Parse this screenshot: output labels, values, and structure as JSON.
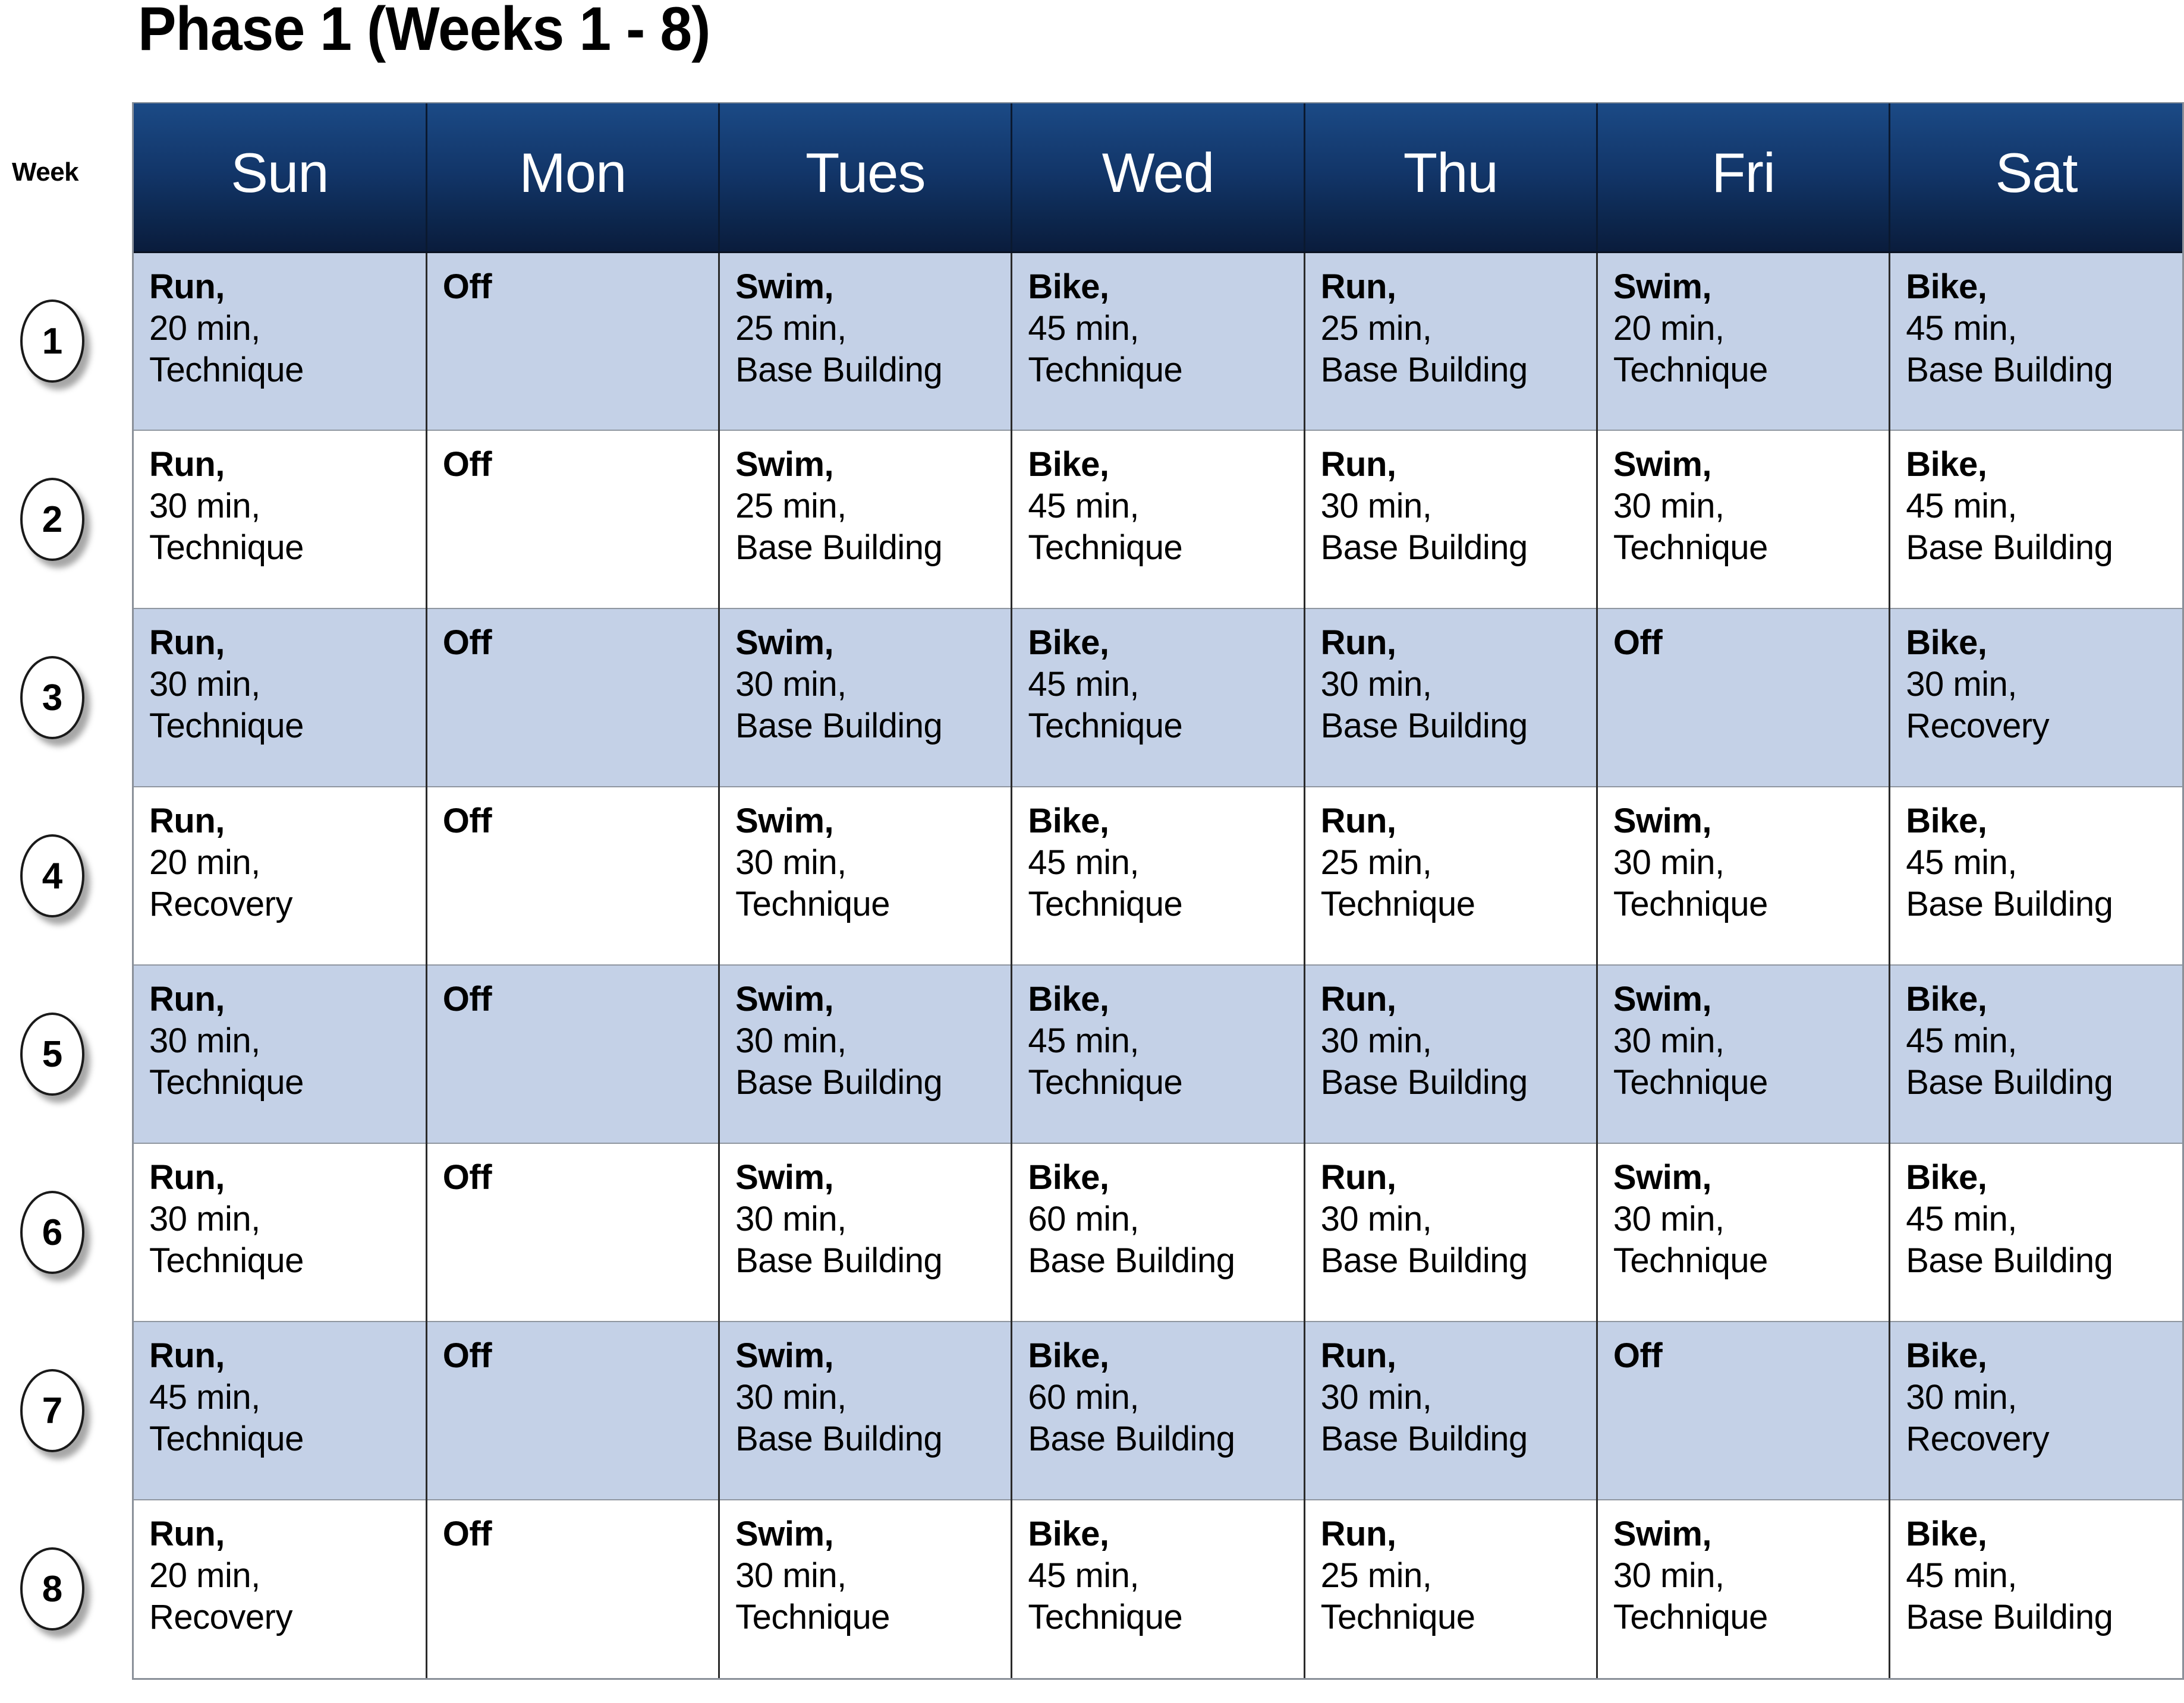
{
  "title": "Phase 1 (Weeks 1 - 8)",
  "week_column_label": "Week",
  "colors": {
    "header_top": "#1b4a86",
    "header_bottom": "#0a1c3c",
    "band_blue": "#c4d1e7",
    "band_white": "#ffffff",
    "text": "#000000",
    "header_text": "#ffffff"
  },
  "columns": [
    {
      "key": "sun",
      "label": "Sun"
    },
    {
      "key": "mon",
      "label": "Mon"
    },
    {
      "key": "tues",
      "label": "Tues"
    },
    {
      "key": "wed",
      "label": "Wed"
    },
    {
      "key": "thu",
      "label": "Thu"
    },
    {
      "key": "fri",
      "label": "Fri"
    },
    {
      "key": "sat",
      "label": "Sat"
    }
  ],
  "rows": [
    {
      "week": "1",
      "shaded": true,
      "cells": [
        {
          "activity": "Run",
          "duration": "20 min",
          "focus": "Technique"
        },
        {
          "activity": "Off",
          "duration": "",
          "focus": ""
        },
        {
          "activity": "Swim",
          "duration": "25 min",
          "focus": "Base Building"
        },
        {
          "activity": "Bike",
          "duration": "45 min",
          "focus": "Technique"
        },
        {
          "activity": "Run",
          "duration": "25 min",
          "focus": "Base Building"
        },
        {
          "activity": "Swim",
          "duration": "20 min",
          "focus": "Technique"
        },
        {
          "activity": "Bike",
          "duration": "45 min",
          "focus": "Base Building"
        }
      ]
    },
    {
      "week": "2",
      "shaded": false,
      "cells": [
        {
          "activity": "Run",
          "duration": "30 min",
          "focus": "Technique"
        },
        {
          "activity": "Off",
          "duration": "",
          "focus": ""
        },
        {
          "activity": "Swim",
          "duration": "25 min",
          "focus": "Base Building"
        },
        {
          "activity": "Bike",
          "duration": "45 min",
          "focus": "Technique"
        },
        {
          "activity": "Run",
          "duration": "30 min",
          "focus": "Base Building"
        },
        {
          "activity": "Swim",
          "duration": "30 min",
          "focus": "Technique"
        },
        {
          "activity": "Bike",
          "duration": "45 min",
          "focus": "Base Building"
        }
      ]
    },
    {
      "week": "3",
      "shaded": true,
      "cells": [
        {
          "activity": "Run",
          "duration": "30 min",
          "focus": "Technique"
        },
        {
          "activity": "Off",
          "duration": "",
          "focus": ""
        },
        {
          "activity": "Swim",
          "duration": "30 min",
          "focus": "Base Building"
        },
        {
          "activity": "Bike",
          "duration": "45 min",
          "focus": "Technique"
        },
        {
          "activity": "Run",
          "duration": "30 min",
          "focus": "Base Building"
        },
        {
          "activity": "Off",
          "duration": "",
          "focus": ""
        },
        {
          "activity": "Bike",
          "duration": "30 min",
          "focus": "Recovery"
        }
      ]
    },
    {
      "week": "4",
      "shaded": false,
      "cells": [
        {
          "activity": "Run",
          "duration": "20 min",
          "focus": "Recovery"
        },
        {
          "activity": "Off",
          "duration": "",
          "focus": ""
        },
        {
          "activity": "Swim",
          "duration": "30 min",
          "focus": "Technique"
        },
        {
          "activity": "Bike",
          "duration": "45 min",
          "focus": "Technique"
        },
        {
          "activity": "Run",
          "duration": "25 min",
          "focus": "Technique"
        },
        {
          "activity": "Swim",
          "duration": "30 min",
          "focus": "Technique"
        },
        {
          "activity": "Bike",
          "duration": "45 min",
          "focus": "Base Building"
        }
      ]
    },
    {
      "week": "5",
      "shaded": true,
      "cells": [
        {
          "activity": "Run",
          "duration": "30 min",
          "focus": "Technique"
        },
        {
          "activity": "Off",
          "duration": "",
          "focus": ""
        },
        {
          "activity": "Swim",
          "duration": "30 min",
          "focus": "Base Building"
        },
        {
          "activity": "Bike",
          "duration": "45 min",
          "focus": "Technique"
        },
        {
          "activity": "Run",
          "duration": "30 min",
          "focus": "Base Building"
        },
        {
          "activity": "Swim",
          "duration": "30 min",
          "focus": "Technique"
        },
        {
          "activity": "Bike",
          "duration": "45 min",
          "focus": "Base Building"
        }
      ]
    },
    {
      "week": "6",
      "shaded": false,
      "cells": [
        {
          "activity": "Run",
          "duration": "30 min",
          "focus": "Technique"
        },
        {
          "activity": "Off",
          "duration": "",
          "focus": ""
        },
        {
          "activity": "Swim",
          "duration": "30 min",
          "focus": "Base Building"
        },
        {
          "activity": "Bike",
          "duration": "60 min",
          "focus": "Base Building"
        },
        {
          "activity": "Run",
          "duration": "30 min",
          "focus": "Base Building"
        },
        {
          "activity": "Swim",
          "duration": "30 min",
          "focus": "Technique"
        },
        {
          "activity": "Bike",
          "duration": "45 min",
          "focus": "Base Building"
        }
      ]
    },
    {
      "week": "7",
      "shaded": true,
      "cells": [
        {
          "activity": "Run",
          "duration": "45 min",
          "focus": "Technique"
        },
        {
          "activity": "Off",
          "duration": "",
          "focus": ""
        },
        {
          "activity": "Swim",
          "duration": "30 min",
          "focus": "Base Building"
        },
        {
          "activity": "Bike",
          "duration": "60 min",
          "focus": "Base Building"
        },
        {
          "activity": "Run",
          "duration": "30 min",
          "focus": "Base Building"
        },
        {
          "activity": "Off",
          "duration": "",
          "focus": ""
        },
        {
          "activity": "Bike",
          "duration": "30 min",
          "focus": "Recovery"
        }
      ]
    },
    {
      "week": "8",
      "shaded": false,
      "cells": [
        {
          "activity": "Run",
          "duration": "20 min",
          "focus": "Recovery"
        },
        {
          "activity": "Off",
          "duration": "",
          "focus": ""
        },
        {
          "activity": "Swim",
          "duration": "30 min",
          "focus": "Technique"
        },
        {
          "activity": "Bike",
          "duration": "45 min",
          "focus": "Technique"
        },
        {
          "activity": "Run",
          "duration": "25 min",
          "focus": "Technique"
        },
        {
          "activity": "Swim",
          "duration": "30 min",
          "focus": "Technique"
        },
        {
          "activity": "Bike",
          "duration": "45 min",
          "focus": "Base Building"
        }
      ]
    }
  ]
}
